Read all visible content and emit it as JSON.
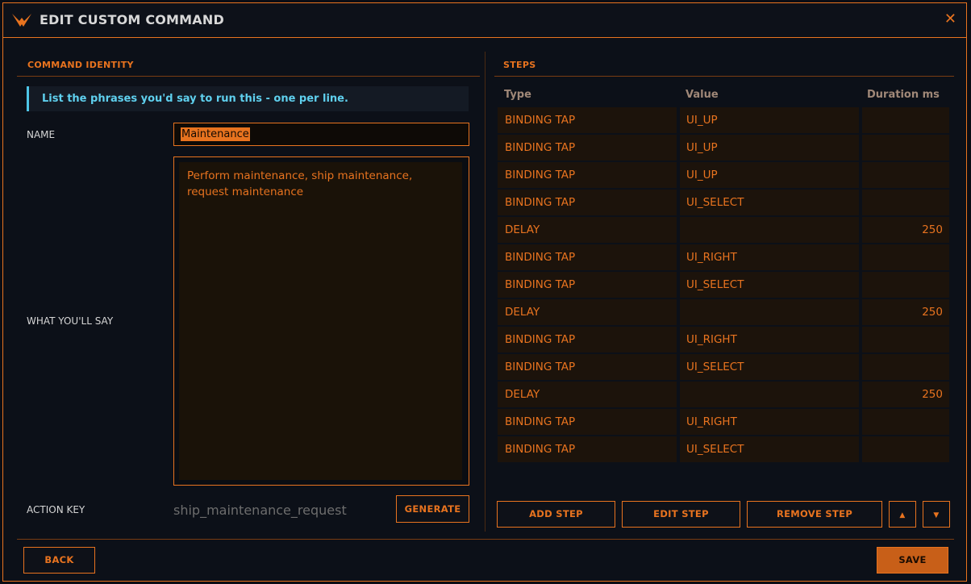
{
  "window": {
    "title": "EDIT CUSTOM COMMAND",
    "close_glyph": "✕",
    "logo_icon": "elite-wings-logo-icon"
  },
  "identity": {
    "section_title": "COMMAND IDENTITY",
    "hint": "List the phrases you'd say to run this - one per line.",
    "name_label": "NAME",
    "name_value": "Maintenance",
    "say_label": "WHAT YOU'LL SAY",
    "say_value": "Perform maintenance, ship maintenance, request maintenance",
    "action_key_label": "ACTION KEY",
    "action_key_value": "ship_maintenance_request",
    "generate_label": "GENERATE"
  },
  "steps": {
    "section_title": "STEPS",
    "columns": [
      "Type",
      "Value",
      "Duration ms"
    ],
    "rows": [
      {
        "type": "BINDING TAP",
        "value": "UI_UP",
        "duration": ""
      },
      {
        "type": "BINDING TAP",
        "value": "UI_UP",
        "duration": ""
      },
      {
        "type": "BINDING TAP",
        "value": "UI_UP",
        "duration": ""
      },
      {
        "type": "BINDING TAP",
        "value": "UI_SELECT",
        "duration": ""
      },
      {
        "type": "DELAY",
        "value": "",
        "duration": "250"
      },
      {
        "type": "BINDING TAP",
        "value": "UI_RIGHT",
        "duration": ""
      },
      {
        "type": "BINDING TAP",
        "value": "UI_SELECT",
        "duration": ""
      },
      {
        "type": "DELAY",
        "value": "",
        "duration": "250"
      },
      {
        "type": "BINDING TAP",
        "value": "UI_RIGHT",
        "duration": ""
      },
      {
        "type": "BINDING TAP",
        "value": "UI_SELECT",
        "duration": ""
      },
      {
        "type": "DELAY",
        "value": "",
        "duration": "250"
      },
      {
        "type": "BINDING TAP",
        "value": "UI_RIGHT",
        "duration": ""
      },
      {
        "type": "BINDING TAP",
        "value": "UI_SELECT",
        "duration": ""
      }
    ],
    "add_label": "ADD STEP",
    "edit_label": "EDIT STEP",
    "remove_label": "REMOVE STEP",
    "move_up_glyph": "▲",
    "move_down_glyph": "▼"
  },
  "footer": {
    "back_label": "BACK",
    "save_label": "SAVE"
  },
  "colors": {
    "accent": "#e8731f",
    "hint": "#5fd0ee",
    "background": "#0c1018",
    "cell": "#1c130b"
  }
}
